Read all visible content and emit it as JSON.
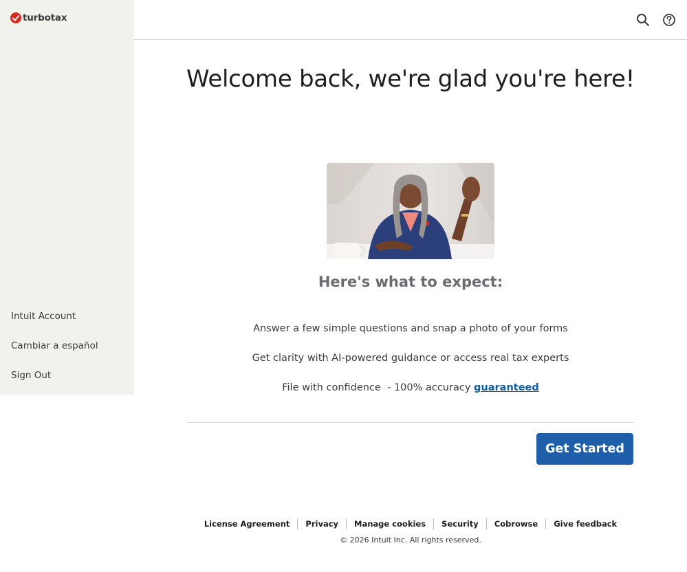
{
  "brand": {
    "name": "turbotax",
    "accent": "#d52b1e"
  },
  "sidebar": {
    "items": [
      {
        "label": "Intuit Account"
      },
      {
        "label": "Cambiar a español"
      },
      {
        "label": "Sign Out"
      }
    ]
  },
  "header": {
    "icons": [
      "search-icon",
      "help-icon"
    ]
  },
  "main": {
    "headline": "Welcome back, we're glad you're here!",
    "subheading": "Here's what to expect:",
    "bullets": [
      "Answer a few simple questions and snap a photo of your forms",
      "Get clarity with AI-powered guidance or access real tax experts"
    ],
    "confidence": {
      "text": "File with confidence  - 100% accuracy ",
      "link": "guaranteed"
    },
    "cta_label": "Get Started",
    "cta_color": "#1f5ea8"
  },
  "footer": {
    "links": [
      "License Agreement",
      "Privacy",
      "Manage cookies",
      "Security",
      "Cobrowse",
      "Give feedback"
    ],
    "copyright": "© 2026 Intuit Inc. All rights reserved."
  }
}
